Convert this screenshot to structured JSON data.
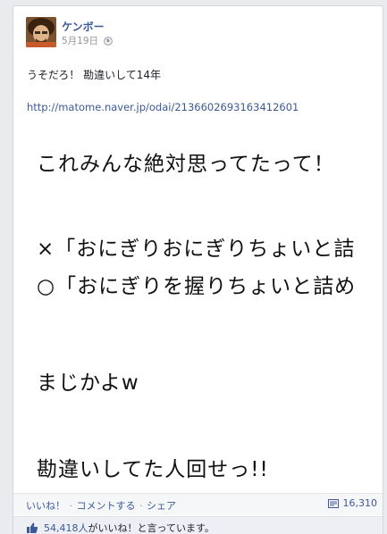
{
  "post": {
    "author": "ケンボー",
    "date": "5月19日",
    "text": "うそだろ！ 勘違いして14年",
    "link": "http://matome.naver.jp/odai/2136602693163412601"
  },
  "image": {
    "line1": "これみんな絶対思ってたって！",
    "line2": "×「おにぎりおにぎりちょいと詰",
    "line3": "○「おにぎりを握りちょいと詰め",
    "line4": "まじかよw",
    "line5": "勘違いしてた人回せっ!!"
  },
  "actions": {
    "like": "いいね！",
    "comment": "コメントする",
    "share": "シェア",
    "separator": " · ",
    "share_count": "16,310"
  },
  "likes": {
    "count": "54,418人",
    "suffix": "がいいね！と言っています。"
  },
  "colors": {
    "link_blue": "#3b5998",
    "page_bg": "#e9ebee",
    "footer_bg": "#f6f7f9",
    "likes_bg": "#edeff4"
  },
  "icons": {
    "privacy": "globe-icon",
    "share": "share-icon",
    "like": "thumbs-up-icon"
  }
}
